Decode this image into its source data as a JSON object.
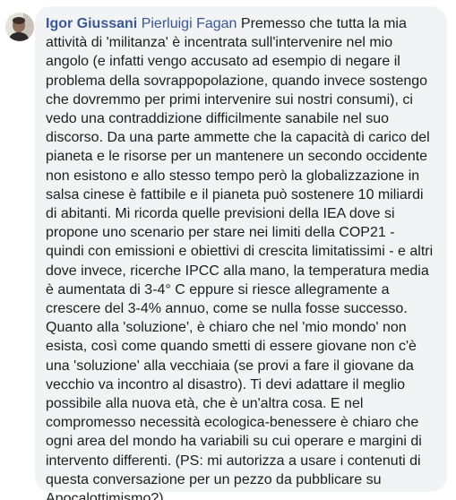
{
  "comment": {
    "author": "Igor Giussani",
    "mention": "Pierluigi Fagan",
    "first_line_rest": "Premesso che tutta la mia",
    "lines": [
      "attività di 'militanza' è incentrata sull'intervenire nel mio",
      "angolo (e infatti vengo accusato ad esempio di negare il",
      "problema della sovrappopolazione, quando invece sostengo",
      "che dovremmo per primi intervenire sui nostri consumi), ci",
      "vedo una contraddizione difficilmente sanabile nel suo",
      "discorso. Da una parte ammette che la capacità di carico del",
      "pianeta e le risorse per un mantenere un secondo occidente",
      "non esistono e allo stesso tempo però la globalizzazione in",
      "salsa cinese è fattibile e il pianeta può sostenere 10 miliardi",
      "di abitanti. Mi ricorda quelle previsioni della IEA dove si",
      "propone uno scenario per stare nei limiti della COP21 -",
      "quindi con emissioni e obiettivi di crescita limitatissimi - e altri",
      "dove invece, ricerche IPCC alla mano, la temperatura media",
      "è aumentata di 3-4° C eppure si riesce allegramente a",
      "crescere del 3-4% annuo, come se nulla fosse successo.",
      "Quanto alla 'soluzione', è chiaro che nel 'mio mondo' non",
      "esista, così come quando smetti di essere giovane non c'è",
      "una 'soluzione' alla vecchiaia (se provi a fare il giovane da",
      "vecchio va incontro al disastro). Ti devi adattare il meglio",
      "possibile alla nuova età, che è un'altra cosa. E nel",
      "compromesso necessità ecologica-benessere è chiaro che",
      "ogni area del mondo ha variabili su cui operare e margini di",
      "intervento differenti. (PS: mi autorizza a usare i contenuti di",
      "questa conversazione per un pezzo da pubblicare su",
      "Apocalottimismo?)"
    ]
  },
  "colors": {
    "bubble_bg": "#f2f3f5",
    "link": "#385898",
    "text": "#1c1e21"
  },
  "icons": {
    "avatar": "profile-photo"
  }
}
